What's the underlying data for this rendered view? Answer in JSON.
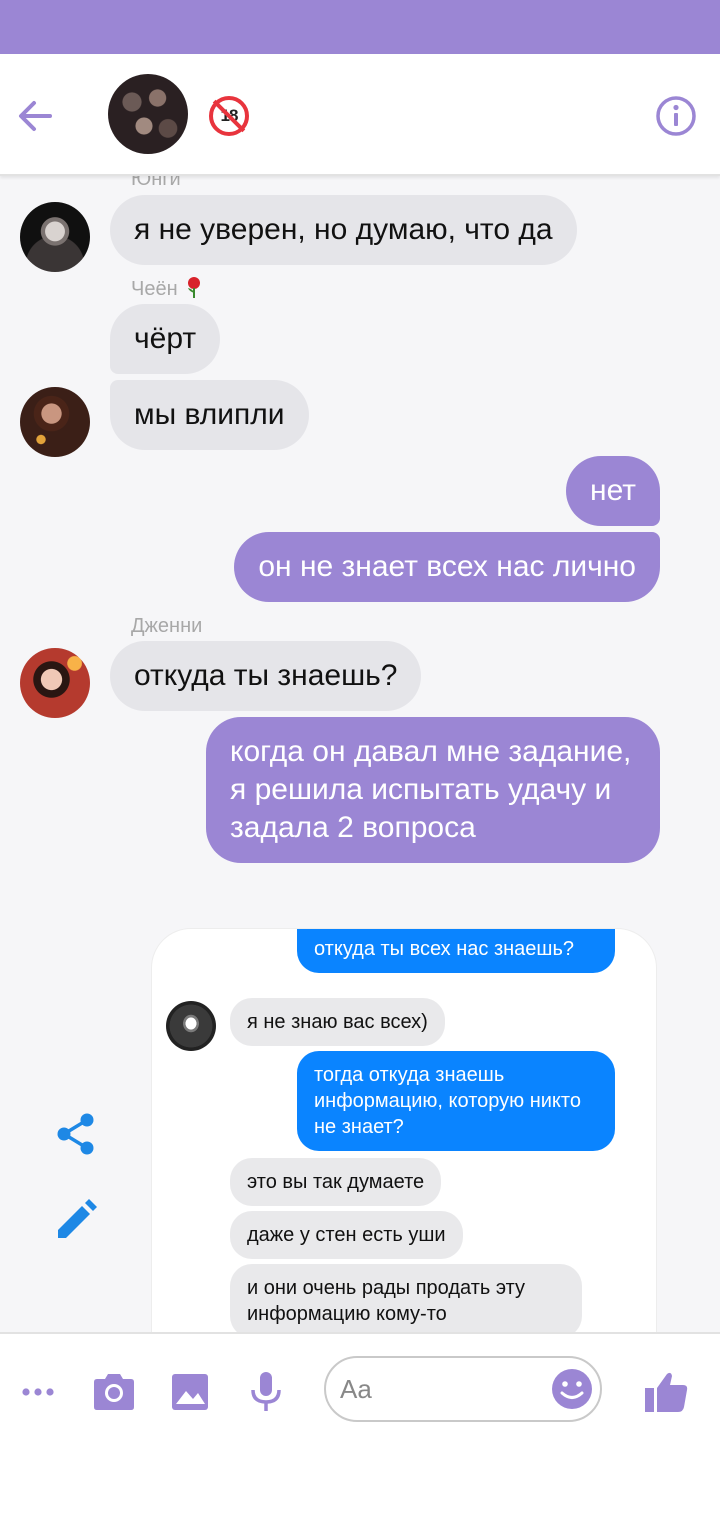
{
  "colors": {
    "accent": "#9b86d4",
    "incoming_bubble": "#e5e5e9",
    "embed_outgoing": "#0a84ff"
  },
  "header": {
    "back_icon": "arrow-left-icon",
    "age_badge": "18",
    "info_icon": "info-icon"
  },
  "messages": [
    {
      "sender": "Юнги",
      "text": "я не уверен, но думаю, что да",
      "direction": "incoming"
    },
    {
      "sender": "Чеён",
      "sender_emoji": "rose",
      "text": "чёрт",
      "direction": "incoming"
    },
    {
      "text": "мы влипли",
      "direction": "incoming"
    },
    {
      "text": "нет",
      "direction": "outgoing"
    },
    {
      "text": "он не знает всех нас лично",
      "direction": "outgoing"
    },
    {
      "sender": "Дженни",
      "text": "откуда ты знаешь?",
      "direction": "incoming"
    },
    {
      "text": "когда он давал мне задание, я решила испытать удачу и задала 2 вопроса",
      "direction": "outgoing"
    }
  ],
  "embedded_screenshot": {
    "messages": [
      {
        "text": "откуда ты всех нас знаешь?",
        "direction": "outgoing"
      },
      {
        "text": "я не знаю вас всех)",
        "direction": "incoming"
      },
      {
        "text": "тогда откуда знаешь информацию, которую никто не знает?",
        "direction": "outgoing"
      },
      {
        "text": "это вы так думаете",
        "direction": "incoming"
      },
      {
        "text": "даже у стен есть уши",
        "direction": "incoming"
      },
      {
        "text": "и они очень рады продать эту информацию кому-то",
        "direction": "incoming"
      }
    ]
  },
  "side_actions": {
    "share_icon": "share-icon",
    "edit_icon": "pencil-icon"
  },
  "composer": {
    "placeholder": "Aa",
    "icons": [
      "more-icon",
      "camera-icon",
      "image-icon",
      "microphone-icon",
      "emoji-icon",
      "thumbs-up-icon"
    ]
  }
}
